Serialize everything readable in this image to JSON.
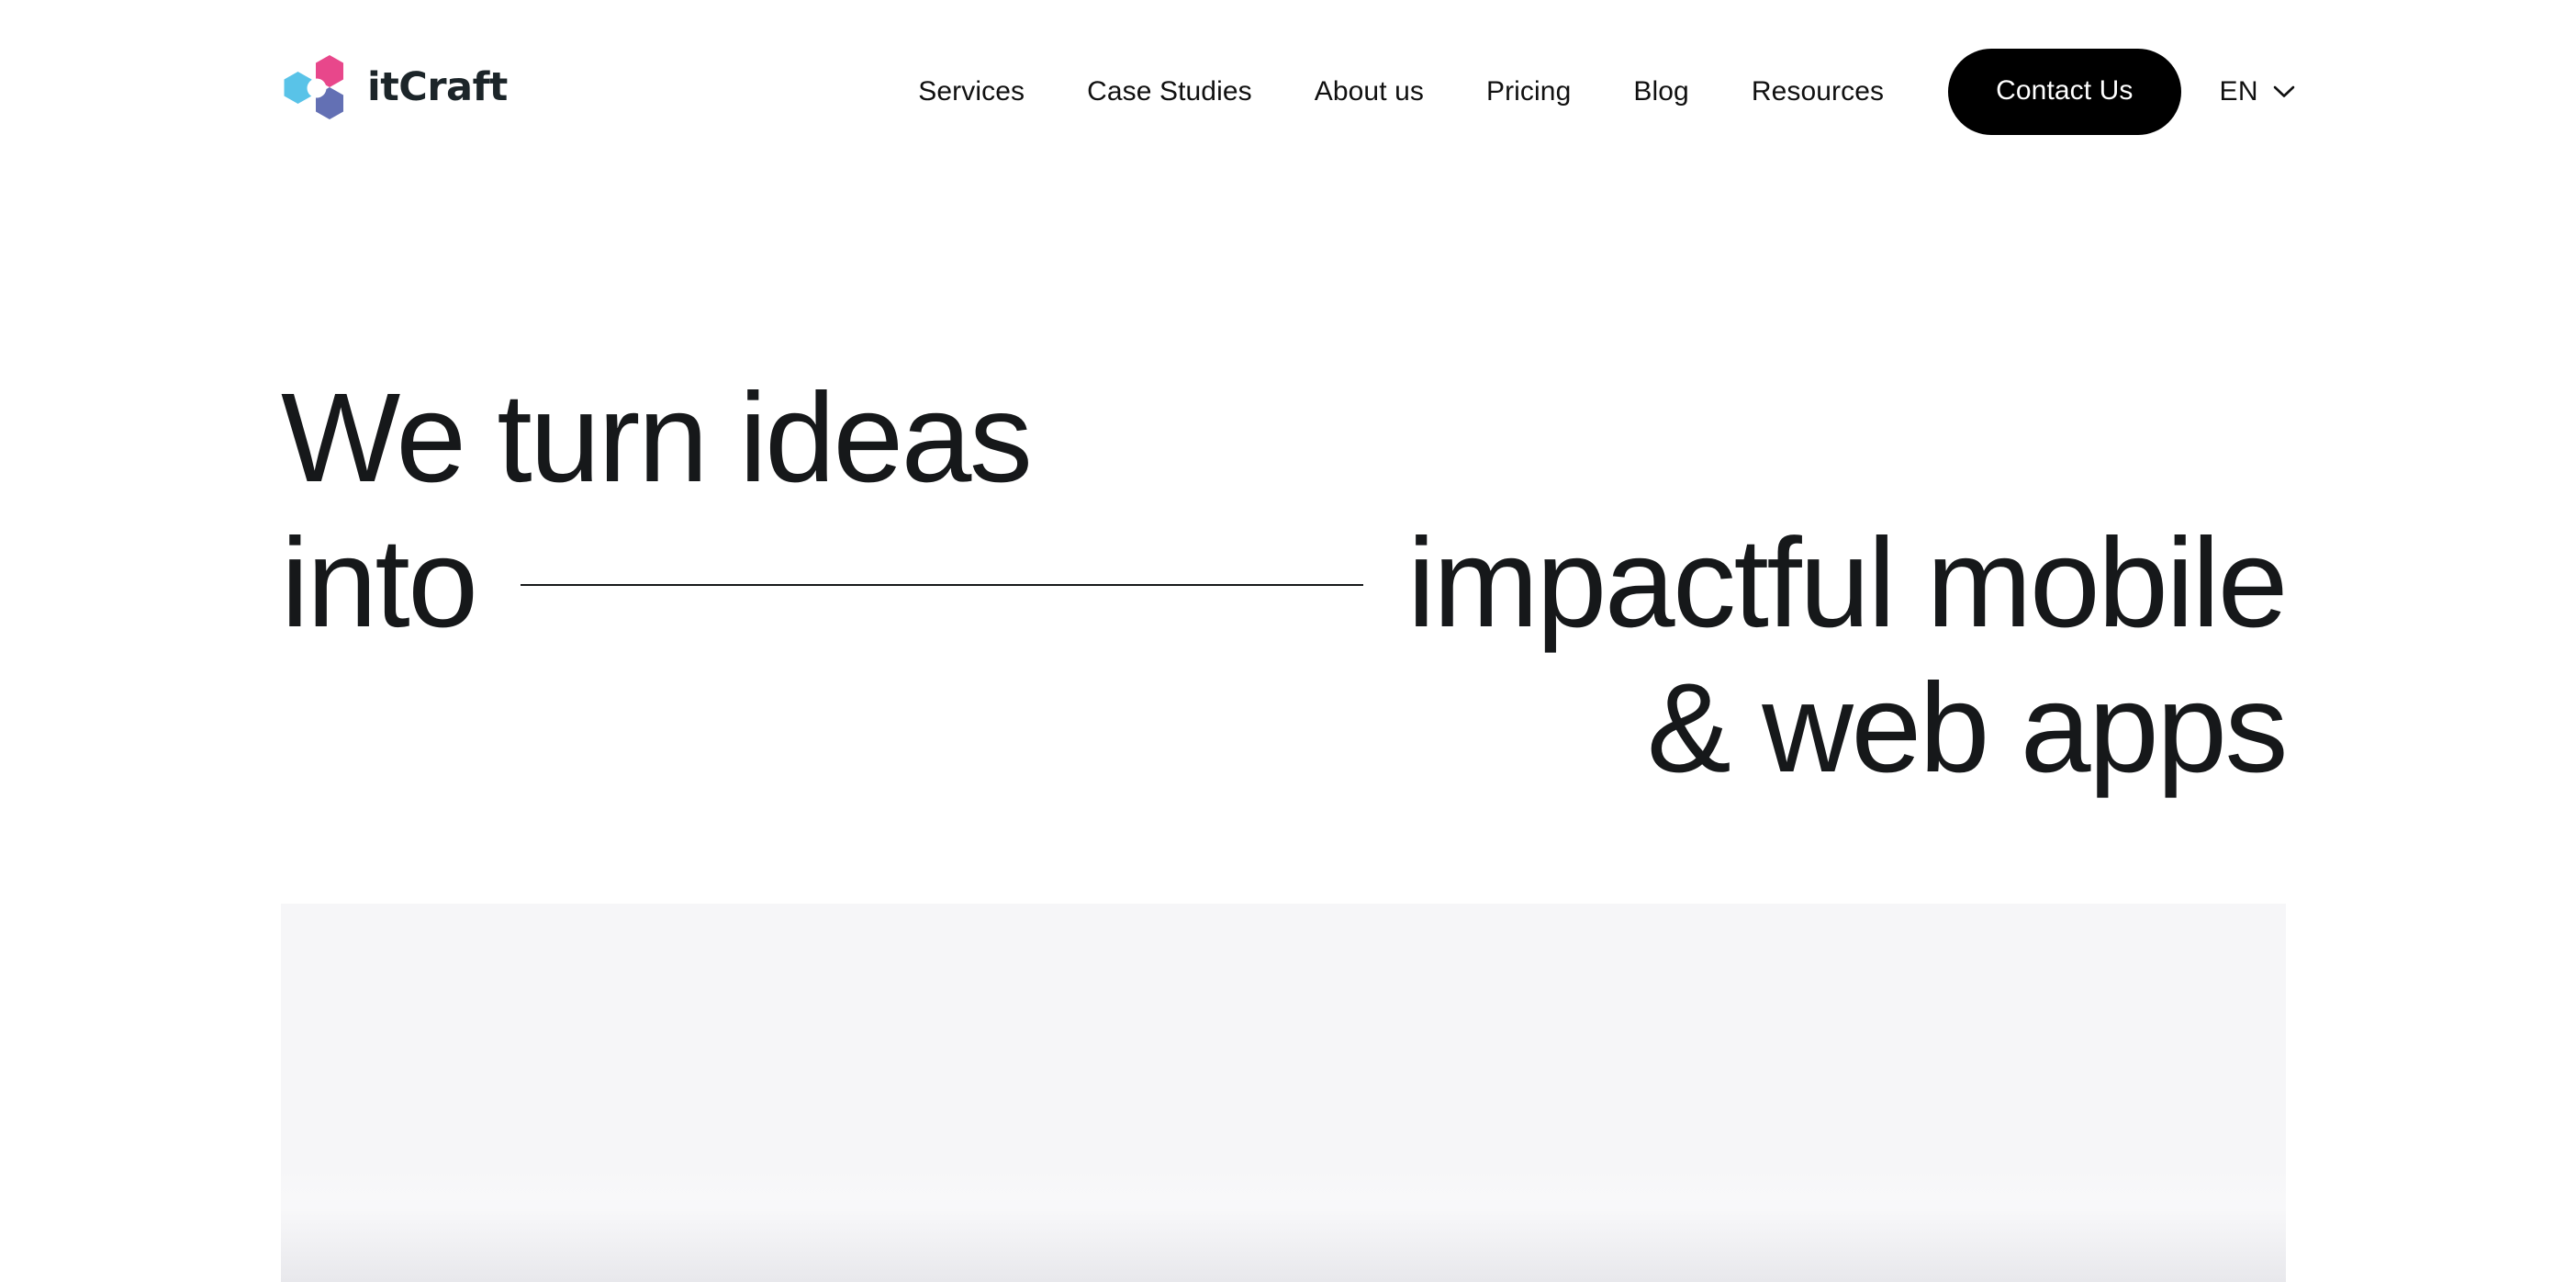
{
  "header": {
    "brand": {
      "name": "itCraft",
      "logo_icon": "itcraft-hexagon-logo",
      "colors": {
        "hex_cyan": "#59c3e8",
        "hex_pink": "#e8478b",
        "hex_purple": "#6370b4",
        "wordmark": "#1c2529"
      }
    },
    "nav": [
      {
        "label": "Services"
      },
      {
        "label": "Case Studies"
      },
      {
        "label": "About us"
      },
      {
        "label": "Pricing"
      },
      {
        "label": "Blog"
      },
      {
        "label": "Resources"
      }
    ],
    "contact_button": {
      "label": "Contact Us",
      "background": "#000000",
      "text_color": "#ffffff"
    },
    "language": {
      "selected": "EN",
      "chevron_icon": "chevron-down-icon"
    }
  },
  "hero": {
    "line1": "We turn ideas",
    "line2_lead": "into",
    "line2_tail": "impactful  mobile",
    "line3": "& web apps",
    "rule_icon": "horizontal-rule-divider",
    "text_color": "#16181a"
  },
  "showcase": {
    "label": "showcase-placeholder-panel",
    "background": "#f6f6f8"
  }
}
